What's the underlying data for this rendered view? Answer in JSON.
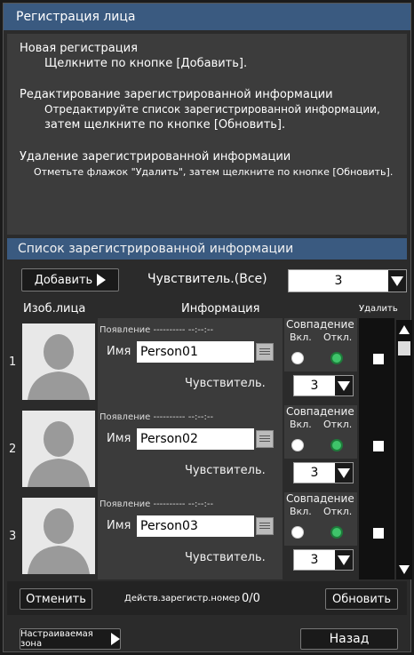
{
  "window": {
    "title": "Регистрация лица"
  },
  "instructions": {
    "new_title": "Новая регистрация",
    "new_line1": "Щелкните по кнопке [Добавить].",
    "edit_title": "Редактирование зарегистрированной информации",
    "edit_line1": "Отредактируйте список зарегистрированной информации,",
    "edit_line2": "затем щелкните по кнопке [Обновить].",
    "delete_title": "Удаление зарегистрированной информации",
    "delete_line1": "Отметьте флажок \"Удалить\", затем щелкните по кнопке [Обновить]."
  },
  "list": {
    "title": "Список зарегистрированной информации",
    "add_label": "Добавить",
    "sensitivity_all_label": "Чувствитель.(Все)",
    "sensitivity_all_value": "3",
    "columns": {
      "photo": "Изоб.лица",
      "info": "Информация",
      "delete": "Удалить"
    },
    "rows": [
      {
        "number": "1",
        "appear": "Появление ---------- --:--:--",
        "name_label": "Имя",
        "name": "Person01",
        "sens_label": "Чувствитель.",
        "sens_value": "3",
        "match_title": "Совпадение",
        "on_label": "Вкл.",
        "off_label": "Откл.",
        "match": "off"
      },
      {
        "number": "2",
        "appear": "Появление ---------- --:--:--",
        "name_label": "Имя",
        "name": "Person02",
        "sens_label": "Чувствитель.",
        "sens_value": "3",
        "match_title": "Совпадение",
        "on_label": "Вкл.",
        "off_label": "Откл.",
        "match": "off"
      },
      {
        "number": "3",
        "appear": "Появление ---------- --:--:--",
        "name_label": "Имя",
        "name": "Person03",
        "sens_label": "Чувствитель.",
        "sens_value": "3",
        "match_title": "Совпадение",
        "on_label": "Вкл.",
        "off_label": "Откл.",
        "match": "off"
      }
    ]
  },
  "footer": {
    "cancel_label": "Отменить",
    "count_label": "Действ.зарегистр.номер",
    "count_value": "0/0",
    "update_label": "Обновить",
    "zone_label": "Настраиваемая зона",
    "back_label": "Назад"
  },
  "colors": {
    "title_bar": "#3a5a80",
    "panel": "#3c3c3c",
    "radio_selected": "#3fc46a"
  }
}
